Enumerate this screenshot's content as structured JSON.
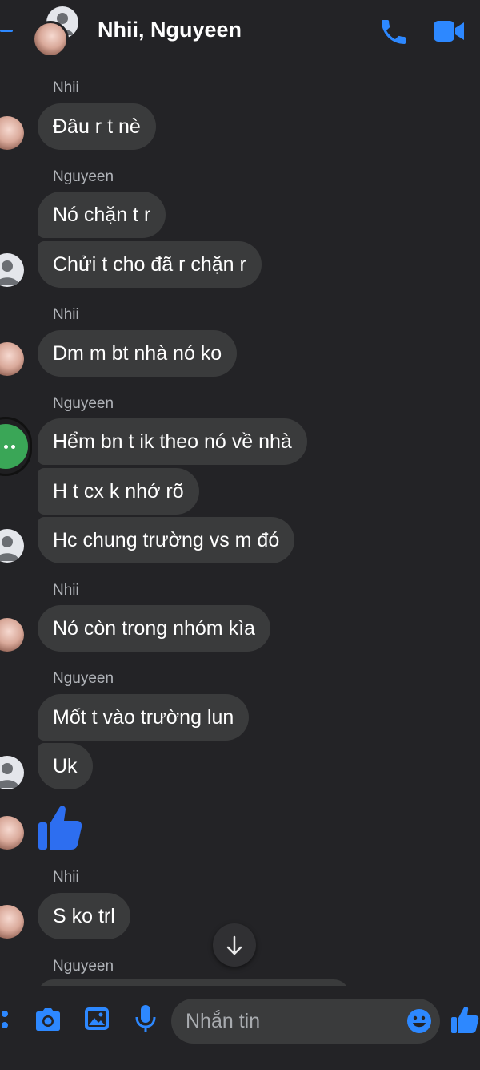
{
  "header": {
    "title": "Nhii, Nguyeen"
  },
  "messages": [
    {
      "sender": "Nhii",
      "texts": [
        "Đâu r t nè"
      ]
    },
    {
      "sender": "Nguyeen",
      "texts": [
        "Nó chặn t r",
        "Chửi  t cho đã r chặn r"
      ]
    },
    {
      "sender": "Nhii",
      "texts": [
        "Dm m bt nhà nó ko"
      ]
    },
    {
      "sender": "Nguyeen",
      "texts": [
        "Hểm bn t ik theo nó về nhà",
        "H t cx k nhớ rõ",
        "Hc chung trường vs m đó"
      ]
    },
    {
      "sender": "Nhii",
      "texts": [
        "Nó còn trong nhóm kìa"
      ]
    },
    {
      "sender": "Nguyeen",
      "texts": [
        "Mốt t vào trường lun",
        "Uk"
      ]
    },
    {
      "sender": "",
      "texts": [],
      "sticker": "thumbs-up-icon"
    },
    {
      "sender": "Nhii",
      "texts": [
        "S ko trl"
      ]
    },
    {
      "sender": "Nguyeen",
      "texts": []
    }
  ],
  "composer": {
    "placeholder": "Nhắn tin"
  },
  "colors": {
    "accent": "#2d88ff",
    "bubble": "#3a3b3c",
    "background": "#232326"
  }
}
